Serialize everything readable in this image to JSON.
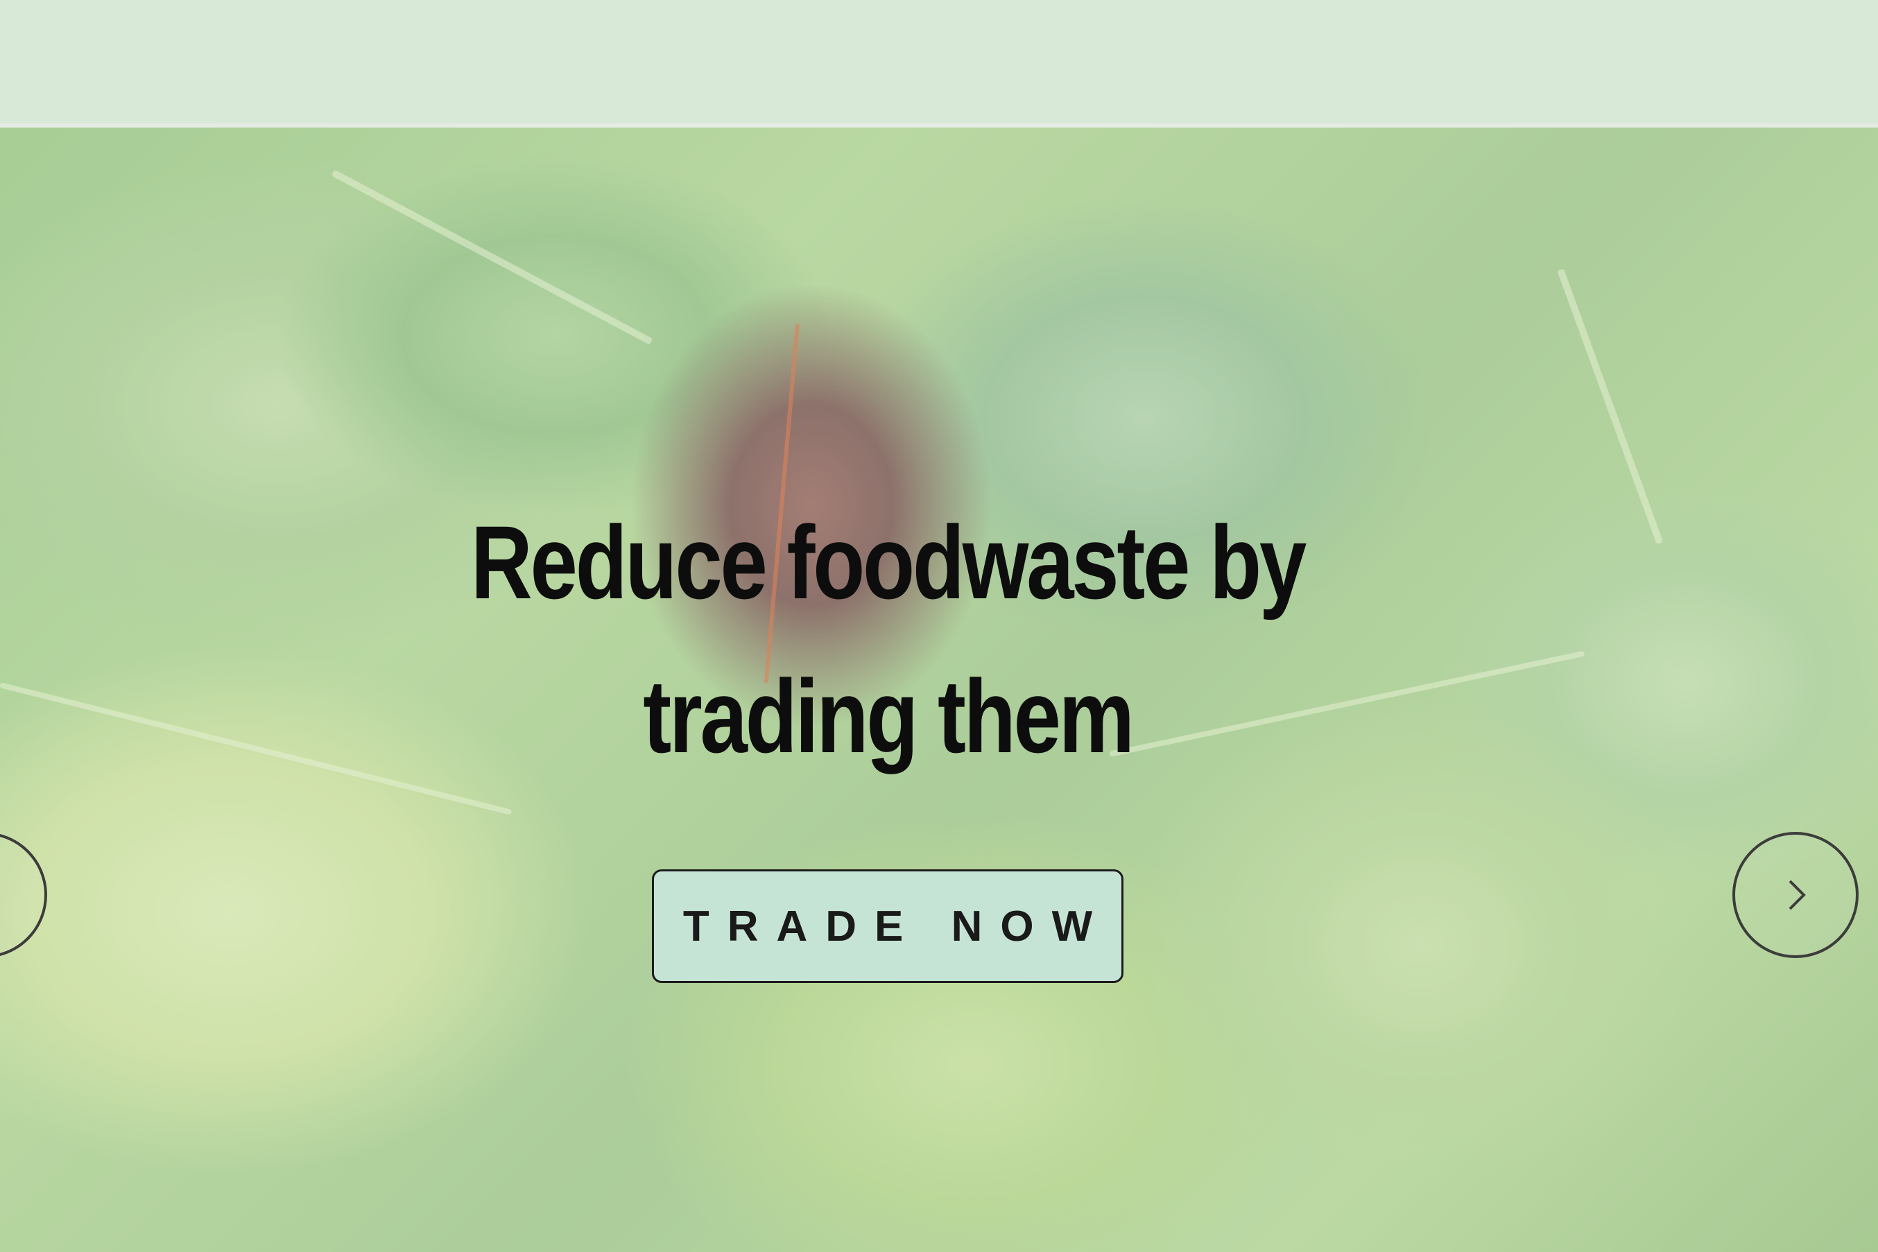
{
  "hero": {
    "headline": "Reduce foodwaste by trading them",
    "cta_label": "TRADE NOW"
  },
  "carousel": {
    "prev_icon": "chevron-left-icon",
    "next_icon": "chevron-right-icon"
  },
  "colors": {
    "header_background": "#d8e9d7",
    "cta_background": "#c6e4d6",
    "text": "#0d0d0d"
  }
}
